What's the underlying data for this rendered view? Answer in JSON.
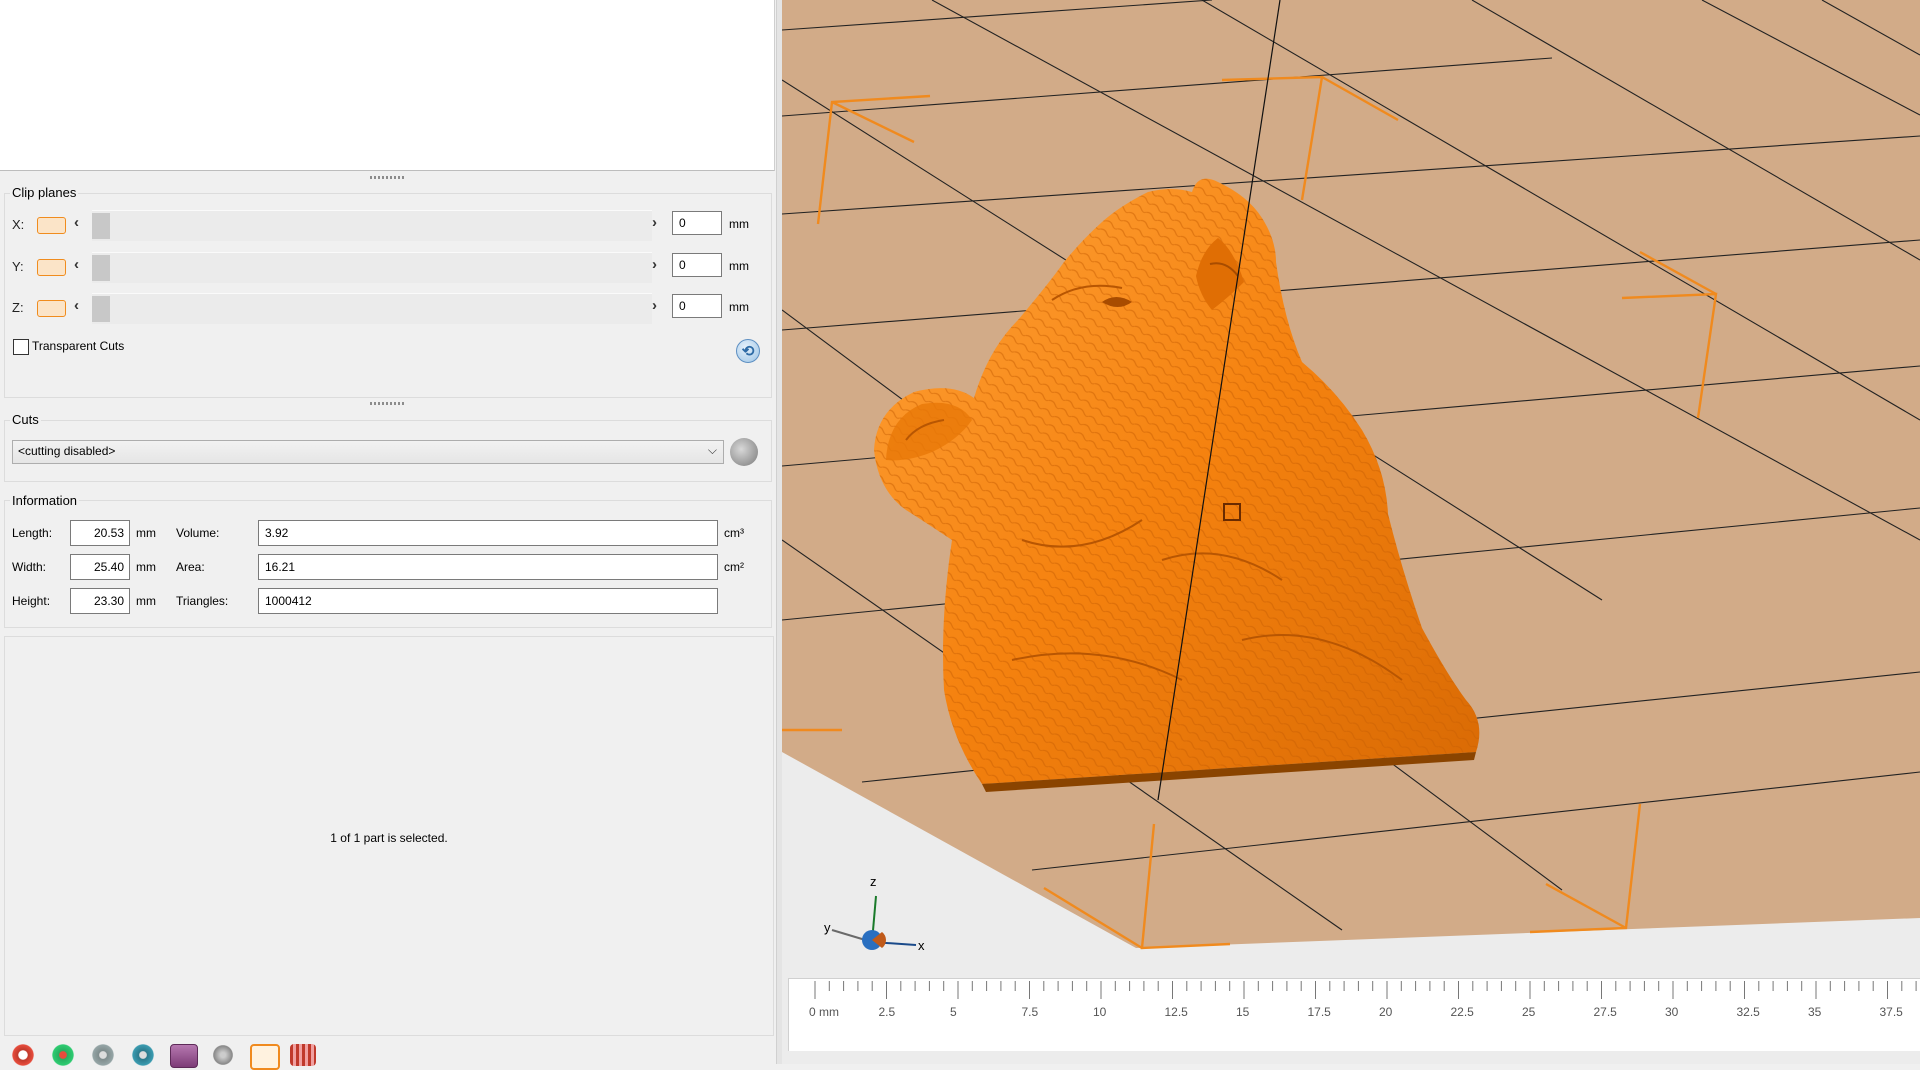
{
  "clip_planes": {
    "title": "Clip planes",
    "rows": [
      {
        "axis": "X:",
        "value": "0",
        "unit": "mm"
      },
      {
        "axis": "Y:",
        "value": "0",
        "unit": "mm"
      },
      {
        "axis": "Z:",
        "value": "0",
        "unit": "mm"
      }
    ],
    "transparent_cuts_label": "Transparent Cuts",
    "transparent_cuts_checked": false
  },
  "cuts": {
    "title": "Cuts",
    "selected": "<cutting disabled>"
  },
  "information": {
    "title": "Information",
    "length_label": "Length:",
    "length_value": "20.53",
    "length_unit": "mm",
    "width_label": "Width:",
    "width_value": "25.40",
    "width_unit": "mm",
    "height_label": "Height:",
    "height_value": "23.30",
    "height_unit": "mm",
    "volume_label": "Volume:",
    "volume_value": "3.92",
    "volume_unit": "cm³",
    "area_label": "Area:",
    "area_value": "16.21",
    "area_unit": "cm²",
    "triangles_label": "Triangles:",
    "triangles_value": "1000412"
  },
  "status": {
    "selection_text": "1 of 1 part is selected."
  },
  "viewport": {
    "axes": {
      "z": "z",
      "y": "y",
      "x": "x"
    },
    "ruler_labels": [
      "0 mm",
      "2.5",
      "5",
      "7.5",
      "10",
      "12.5",
      "15",
      "17.5",
      "20",
      "22.5",
      "25",
      "27.5",
      "30",
      "32.5",
      "35",
      "37.5"
    ],
    "model_color": "#f5820f",
    "bed_color": "#d2ab88",
    "bbox_color": "#f08a1e"
  },
  "toolbar_icons": [
    "settings-gear-icon",
    "mesh-repair-icon",
    "rotate-left-icon",
    "rotate-right-icon",
    "box-view-icon",
    "sphere-view-icon",
    "select-part-icon",
    "grid-tool-icon"
  ]
}
